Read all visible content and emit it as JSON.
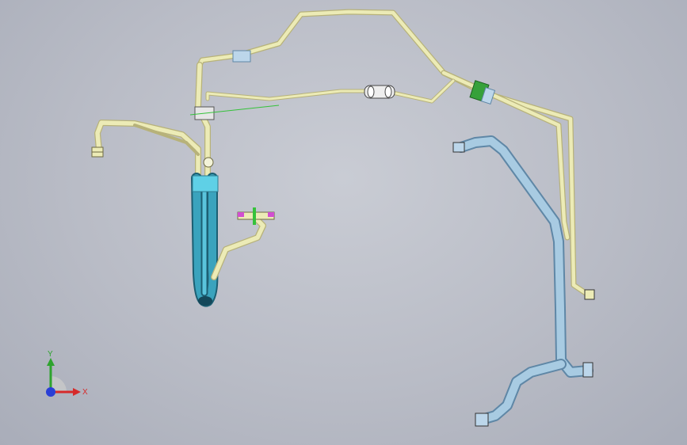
{
  "viewport": {
    "background": "#bfc2cb"
  },
  "colors": {
    "pipe_yellow": "#ecebb6",
    "pipe_yellow_edge": "#b7b27a",
    "pipe_blue": "#9fc3dc",
    "pipe_blue_edge": "#5f87a6",
    "hose_teal": "#2f93ad",
    "hose_teal_light": "#5fd0e6",
    "coupling_green": "#36a13a",
    "sketch_green": "#35c23a",
    "clamp_magenta": "#d14fd0",
    "axis_x": "#d62a2a",
    "axis_y": "#2ea32e",
    "axis_z": "#2a3fd6"
  },
  "triad": {
    "x_label": "X",
    "y_label": "Y"
  }
}
